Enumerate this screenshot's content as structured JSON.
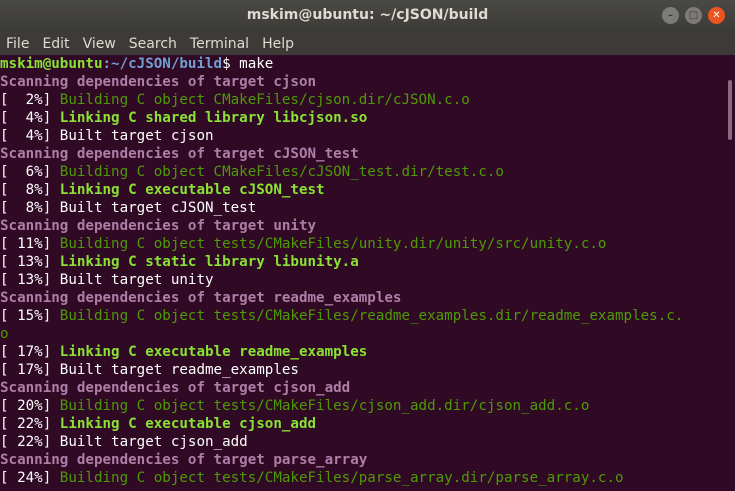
{
  "window": {
    "title": "mskim@ubuntu: ~/cJSON/build"
  },
  "menu": [
    "File",
    "Edit",
    "View",
    "Search",
    "Terminal",
    "Help"
  ],
  "prompt": {
    "user": "mskim@ubuntu",
    "path": ":~/cJSON/build",
    "rest": "$ make"
  },
  "lines": [
    {
      "type": "scan",
      "text": "Scanning dependencies of target cjson"
    },
    {
      "type": "build",
      "pct": "[  2%] ",
      "text": "Building C object CMakeFiles/cjson.dir/cJSON.c.o"
    },
    {
      "type": "link",
      "pct": "[  4%] ",
      "text": "Linking C shared library libcjson.so"
    },
    {
      "type": "plain",
      "pct": "[  4%] ",
      "text": "Built target cjson"
    },
    {
      "type": "scan",
      "text": "Scanning dependencies of target cJSON_test"
    },
    {
      "type": "build",
      "pct": "[  6%] ",
      "text": "Building C object CMakeFiles/cJSON_test.dir/test.c.o"
    },
    {
      "type": "link",
      "pct": "[  8%] ",
      "text": "Linking C executable cJSON_test"
    },
    {
      "type": "plain",
      "pct": "[  8%] ",
      "text": "Built target cJSON_test"
    },
    {
      "type": "scan",
      "text": "Scanning dependencies of target unity"
    },
    {
      "type": "build",
      "pct": "[ 11%] ",
      "text": "Building C object tests/CMakeFiles/unity.dir/unity/src/unity.c.o"
    },
    {
      "type": "link",
      "pct": "[ 13%] ",
      "text": "Linking C static library libunity.a"
    },
    {
      "type": "plain",
      "pct": "[ 13%] ",
      "text": "Built target unity"
    },
    {
      "type": "scan",
      "text": "Scanning dependencies of target readme_examples"
    },
    {
      "type": "build",
      "pct": "[ 15%] ",
      "text": "Building C object tests/CMakeFiles/readme_examples.dir/readme_examples.c."
    },
    {
      "type": "build",
      "pct": "",
      "text": "o"
    },
    {
      "type": "link",
      "pct": "[ 17%] ",
      "text": "Linking C executable readme_examples"
    },
    {
      "type": "plain",
      "pct": "[ 17%] ",
      "text": "Built target readme_examples"
    },
    {
      "type": "scan",
      "text": "Scanning dependencies of target cjson_add"
    },
    {
      "type": "build",
      "pct": "[ 20%] ",
      "text": "Building C object tests/CMakeFiles/cjson_add.dir/cjson_add.c.o"
    },
    {
      "type": "link",
      "pct": "[ 22%] ",
      "text": "Linking C executable cjson_add"
    },
    {
      "type": "plain",
      "pct": "[ 22%] ",
      "text": "Built target cjson_add"
    },
    {
      "type": "scan",
      "text": "Scanning dependencies of target parse_array"
    },
    {
      "type": "build",
      "pct": "[ 24%] ",
      "text": "Building C object tests/CMakeFiles/parse_array.dir/parse_array.c.o"
    }
  ],
  "colors": {
    "background": "#300a24",
    "scan": "#ad7fa8",
    "build": "#4e9a06",
    "link": "#8ae234",
    "prompt_path": "#729fcf"
  }
}
